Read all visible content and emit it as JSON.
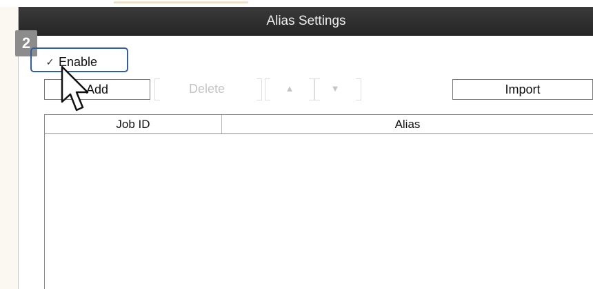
{
  "dialog": {
    "title": "Alias Settings",
    "step_badge": "2",
    "enable": {
      "label": "Enable",
      "checked": true,
      "check_glyph": "✓"
    },
    "toolbar": {
      "add_label": "Add",
      "delete_label": "Delete",
      "move_up_glyph": "▲",
      "move_down_glyph": "▼",
      "import_label": "Import"
    },
    "table": {
      "columns": [
        "Job ID",
        "Alias"
      ],
      "rows": []
    }
  },
  "colors": {
    "titlebar": "#2b2b2b",
    "highlight_border": "#2f5f9e",
    "step_badge": "#8c8c8c",
    "disabled_text": "#c4c4c4"
  },
  "icons": {
    "cursor": "arrow-pointer-icon"
  }
}
